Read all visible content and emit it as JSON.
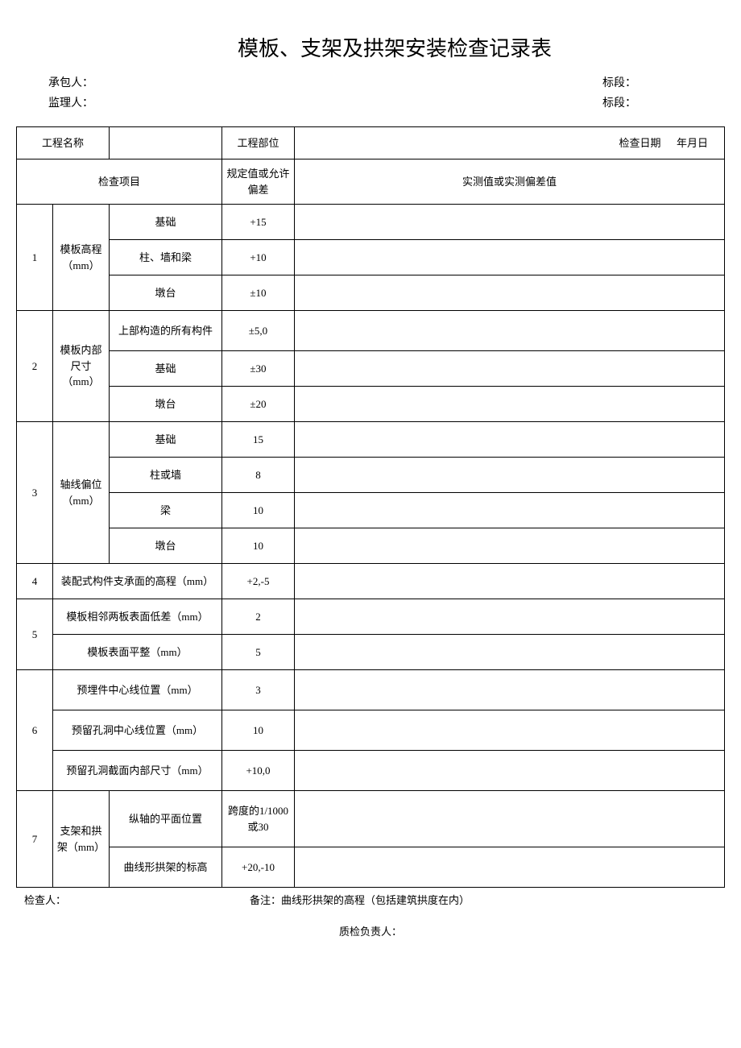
{
  "title": "模板、支架及拱架安装检查记录表",
  "header": {
    "contractor_label": "承包人：",
    "supervisor_label": "监理人：",
    "section_label": "标段："
  },
  "table": {
    "project_name_label": "工程名称",
    "project_name_value": "",
    "project_part_label": "工程部位",
    "project_part_value": "",
    "check_date_label": "检查日期",
    "check_date_value": "年月日",
    "check_item_header": "检查项目",
    "spec_header": "规定值或允许偏差",
    "measured_header": "实测值或实测偏差值",
    "rows": {
      "r1": {
        "num": "1",
        "cat": "模板高程（mm）",
        "items": [
          "基础",
          "柱、墙和梁",
          "墩台"
        ],
        "specs": [
          "+15",
          "+10",
          "±10"
        ]
      },
      "r2": {
        "num": "2",
        "cat": "模板内部尺寸（mm）",
        "items": [
          "上部构造的所有构件",
          "基础",
          "墩台"
        ],
        "specs": [
          "±5,0",
          "±30",
          "±20"
        ]
      },
      "r3": {
        "num": "3",
        "cat": "轴线偏位（mm）",
        "items": [
          "基础",
          "柱或墙",
          "梁",
          "墩台"
        ],
        "specs": [
          "15",
          "8",
          "10",
          "10"
        ]
      },
      "r4": {
        "num": "4",
        "item": "装配式构件支承面的高程（mm）",
        "spec": "+2,-5"
      },
      "r5": {
        "num": "5",
        "items": [
          "模板相邻两板表面低差（mm）",
          "模板表面平整（mm）"
        ],
        "specs": [
          "2",
          "5"
        ]
      },
      "r6": {
        "num": "6",
        "items": [
          "预埋件中心线位置（mm）",
          "预留孔洞中心线位置（mm）",
          "预留孔洞截面内部尺寸（mm）"
        ],
        "specs": [
          "3",
          "10",
          "+10,0"
        ]
      },
      "r7": {
        "num": "7",
        "cat": "支架和拱架（mm）",
        "items": [
          "纵轴的平面位置",
          "曲线形拱架的标高"
        ],
        "specs": [
          "跨度的1/1000 或30",
          "+20,-10"
        ]
      }
    }
  },
  "footer": {
    "inspector_label": "检查人：",
    "remark": "备注：曲线形拱架的高程（包括建筑拱度在内）",
    "qc_label": "质检负责人："
  }
}
